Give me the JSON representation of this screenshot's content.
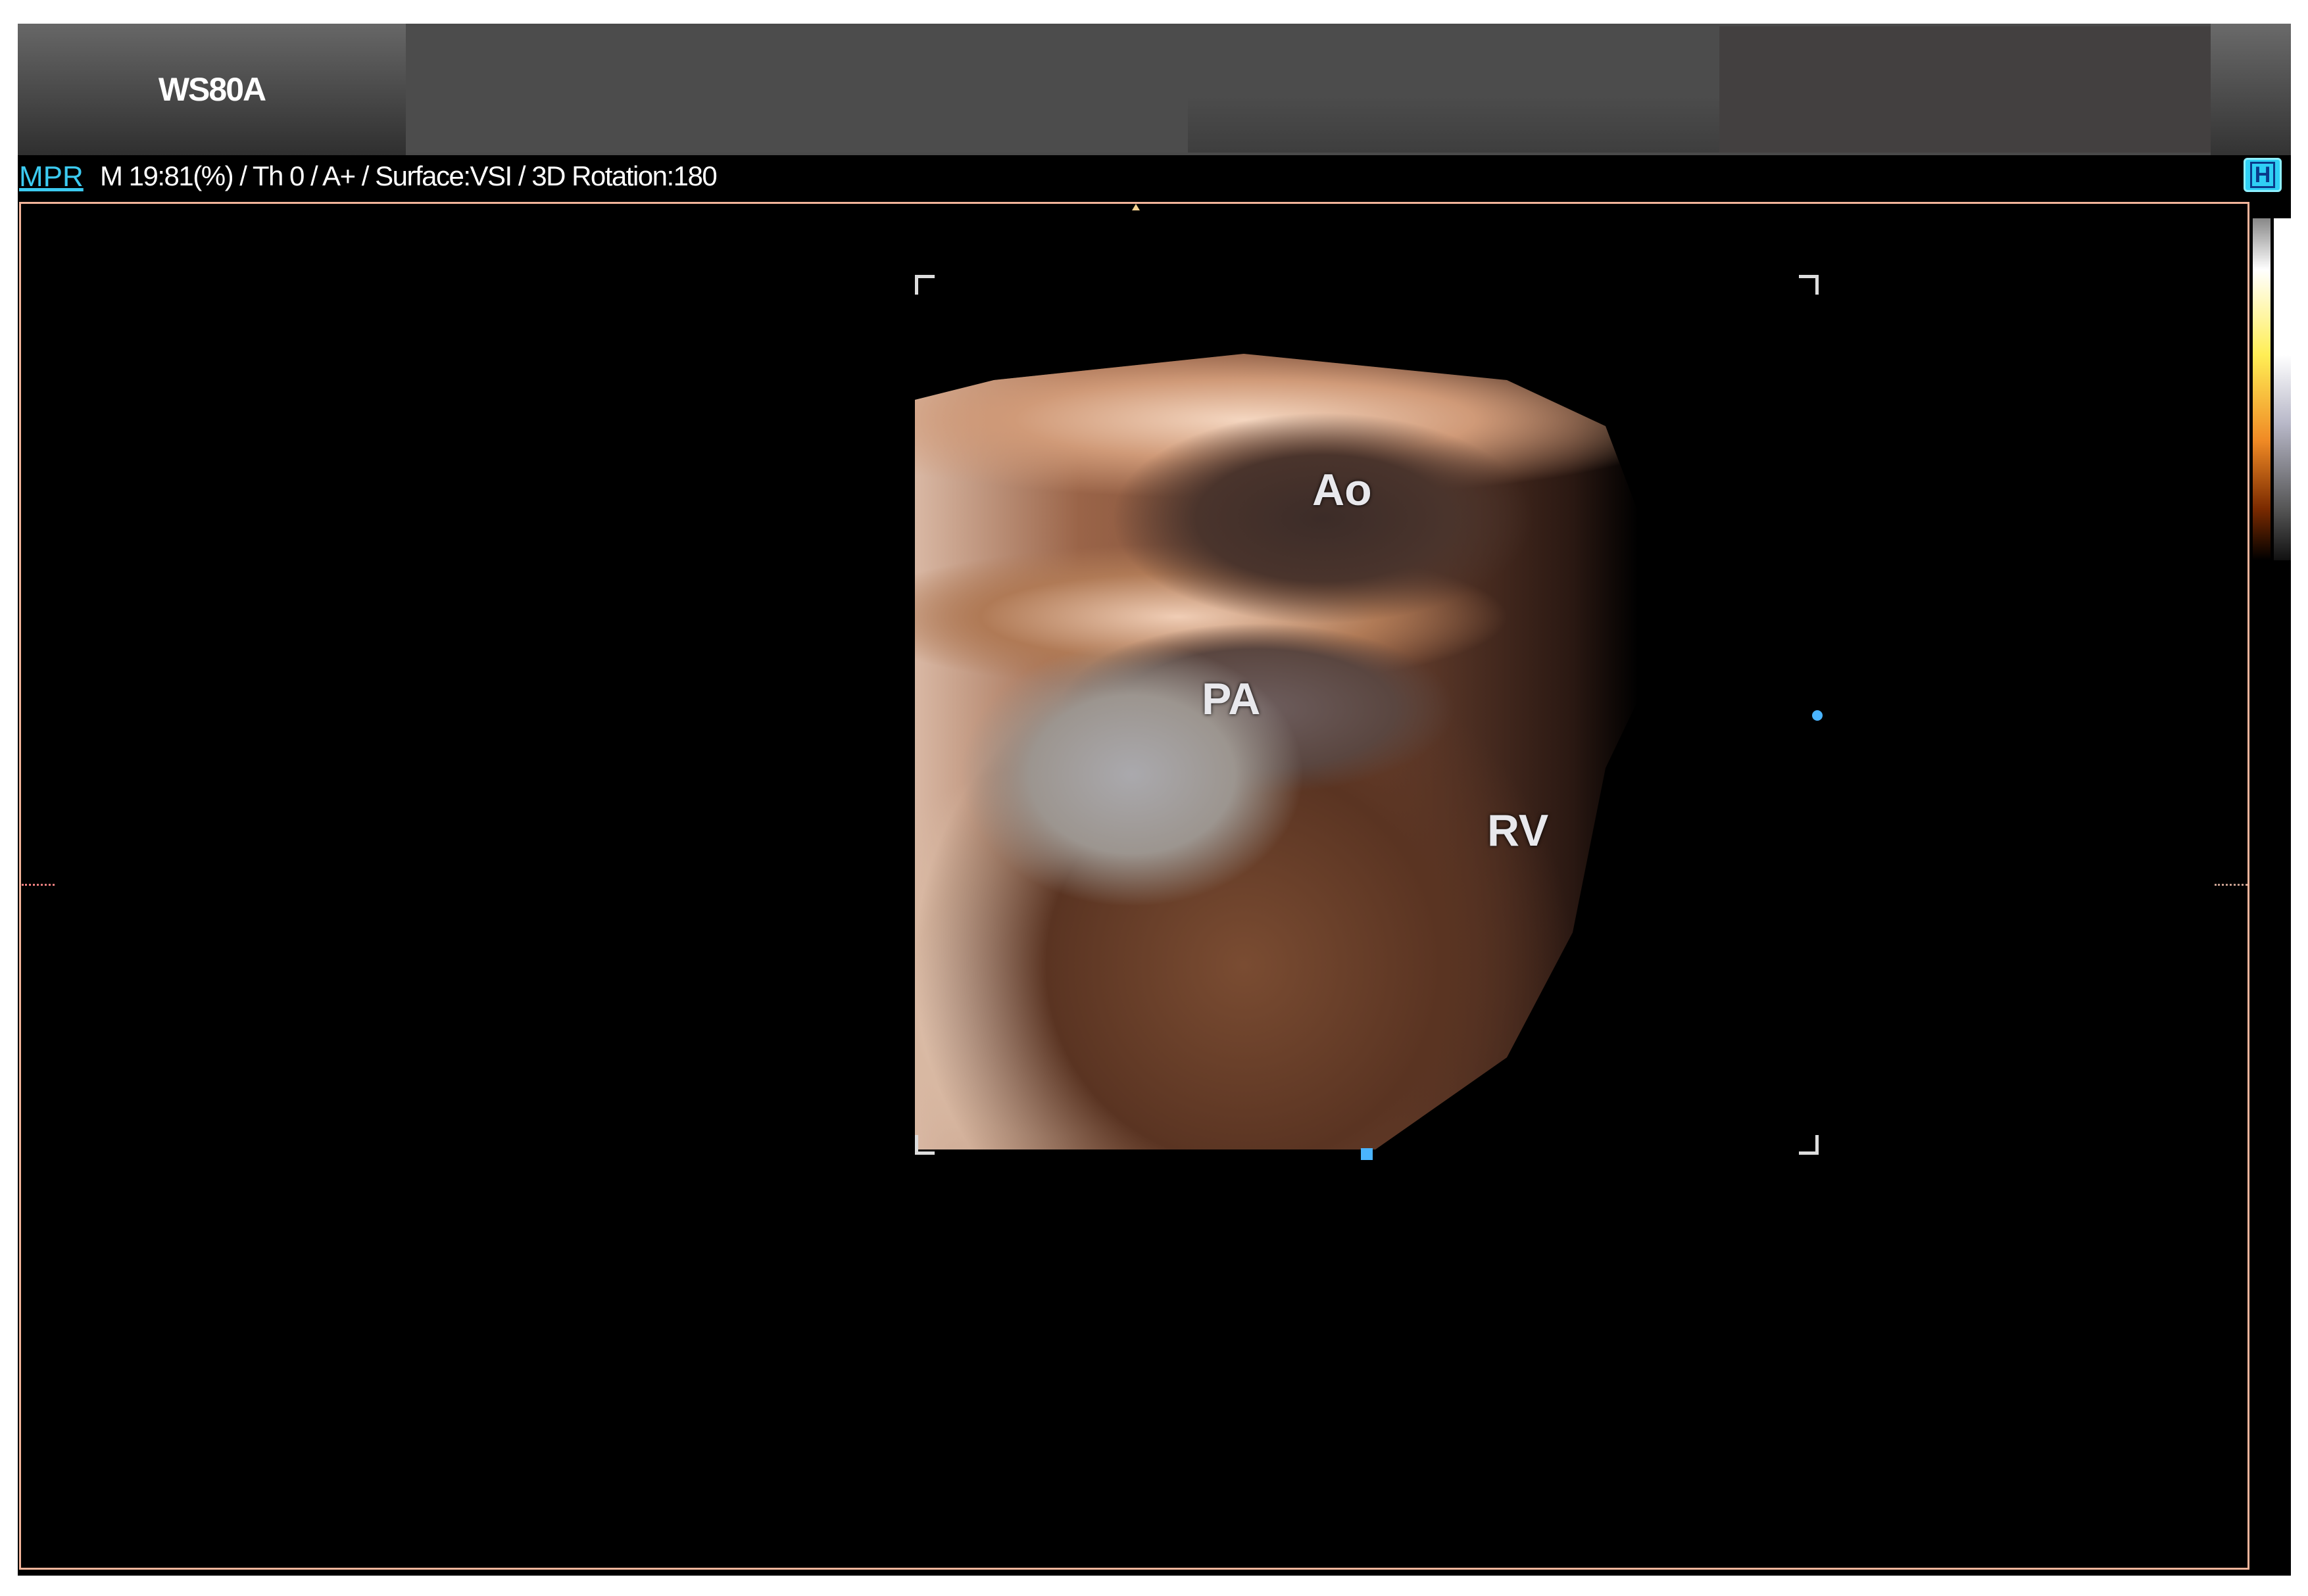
{
  "header": {
    "brand": "WS80A"
  },
  "info": {
    "mode": "MPR",
    "params": "M 19:81(%) / Th 0 / A+ / Surface:VSI / 3D Rotation:180"
  },
  "hicon": {
    "label": "H",
    "icon": "h-view-icon"
  },
  "image": {
    "labels": {
      "ao": "Ao",
      "pa": "PA",
      "rv": "RV"
    }
  },
  "colors": {
    "accent": "#3ccaf0",
    "frame": "#f2b49a",
    "marker": "#4ab4ff"
  }
}
